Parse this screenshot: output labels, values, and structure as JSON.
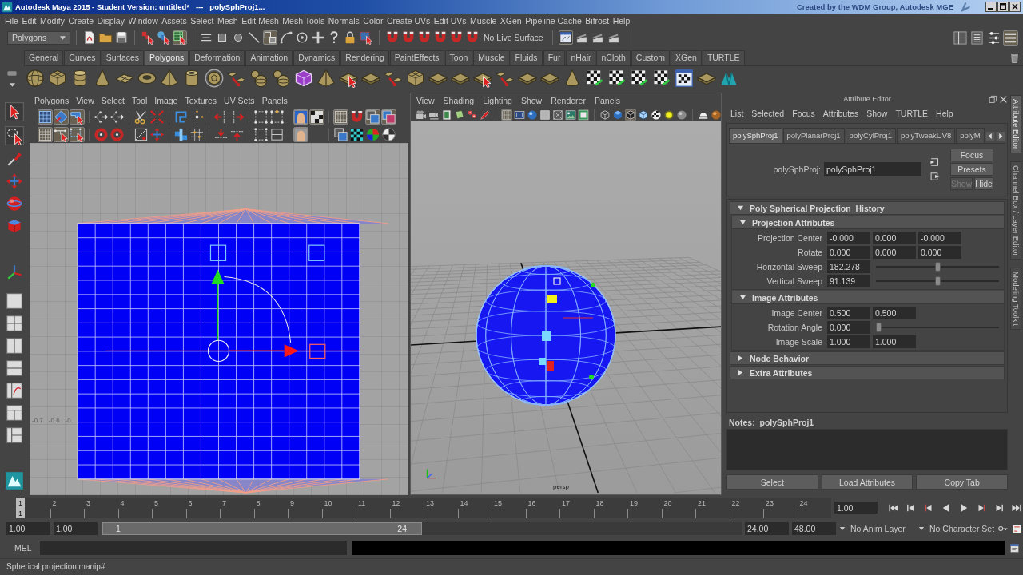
{
  "window": {
    "title": "Autodesk Maya 2015 - Student Version: untitled*   ---   polySphProj1...",
    "credit": "Created by the WDM Group, Autodesk MGE"
  },
  "menu_bar": [
    "File",
    "Edit",
    "Modify",
    "Create",
    "Display",
    "Window",
    "Assets",
    "Select",
    "Mesh",
    "Edit Mesh",
    "Mesh Tools",
    "Normals",
    "Color",
    "Create UVs",
    "Edit UVs",
    "Muscle",
    "XGen",
    "Pipeline Cache",
    "Bifrost",
    "Help"
  ],
  "status_line": {
    "menu_set": "Polygons",
    "buttons": [
      {
        "pressed": false
      },
      {
        "pressed": false
      },
      {
        "pressed": false
      },
      {
        "pressed": false
      },
      {
        "pressed": false
      },
      {
        "pressed": true
      },
      {
        "pressed": false
      },
      {
        "pressed": false
      },
      {
        "pressed": false
      },
      {
        "pressed": false
      },
      {
        "pressed": true
      },
      {
        "pressed": false
      },
      {
        "pressed": false
      },
      {
        "pressed": false
      },
      {
        "pressed": false
      },
      {
        "pressed": false
      },
      {
        "pressed": false
      },
      {
        "pressed": false
      },
      {
        "pressed": false
      },
      {
        "pressed": false
      },
      {
        "pressed": false
      },
      {
        "pressed": false
      },
      {
        "pressed": false
      }
    ],
    "live_surface": "No Live Surface",
    "render_buttons": [
      {
        "pressed": true
      },
      {
        "pressed": false
      },
      {
        "pressed": false
      },
      {
        "pressed": false
      }
    ],
    "panel_toggles": [
      {
        "pressed": false
      },
      {
        "pressed": false
      },
      {
        "pressed": false
      },
      {
        "pressed": true
      }
    ]
  },
  "shelf": {
    "tabs": [
      {
        "label": "General",
        "selected": false
      },
      {
        "label": "Curves",
        "selected": false
      },
      {
        "label": "Surfaces",
        "selected": false
      },
      {
        "label": "Polygons",
        "selected": true
      },
      {
        "label": "Deformation",
        "selected": false
      },
      {
        "label": "Animation",
        "selected": false
      },
      {
        "label": "Dynamics",
        "selected": false
      },
      {
        "label": "Rendering",
        "selected": false
      },
      {
        "label": "PaintEffects",
        "selected": false
      },
      {
        "label": "Toon",
        "selected": false
      },
      {
        "label": "Muscle",
        "selected": false
      },
      {
        "label": "Fluids",
        "selected": false
      },
      {
        "label": "Fur",
        "selected": false
      },
      {
        "label": "nHair",
        "selected": false
      },
      {
        "label": "nCloth",
        "selected": false
      },
      {
        "label": "Custom",
        "selected": false
      },
      {
        "label": "XGen",
        "selected": false
      },
      {
        "label": "TURTLE",
        "selected": false
      }
    ]
  },
  "uv_editor": {
    "menu": [
      "Polygons",
      "View",
      "Select",
      "Tool",
      "Image",
      "Textures",
      "UV Sets",
      "Panels"
    ],
    "toolbar_rows": [
      {
        "buttons": [
          {
            "pressed": true
          },
          {
            "pressed": true
          },
          {
            "pressed": true
          },
          {
            "pressed": false
          },
          {
            "pressed": false
          },
          {
            "pressed": false
          },
          {
            "pressed": false
          },
          {
            "pressed": false
          },
          {
            "pressed": false
          },
          {
            "pressed": false
          },
          {
            "pressed": false
          },
          {
            "pressed": false
          },
          {
            "pressed": false
          },
          {
            "pressed": true
          },
          {
            "pressed": true
          },
          {
            "pressed": true
          },
          {
            "pressed": false
          },
          {
            "pressed": true
          },
          {
            "pressed": true
          }
        ]
      },
      {
        "buttons": [
          {
            "pressed": true
          },
          {
            "pressed": true
          },
          {
            "pressed": true
          },
          {
            "pressed": false
          },
          {
            "pressed": false
          },
          {
            "pressed": false
          },
          {
            "pressed": false
          },
          {
            "pressed": false
          },
          {
            "pressed": false
          },
          {
            "pressed": false
          },
          {
            "pressed": false
          },
          {
            "pressed": false
          },
          {
            "pressed": false
          },
          {
            "pressed": true
          },
          {
            "pressed": false
          },
          {
            "pressed": false
          },
          {
            "pressed": false
          },
          {
            "pressed": false
          }
        ]
      }
    ],
    "axis_labels": [
      "-0.7",
      "-0.6",
      "-0."
    ]
  },
  "viewport": {
    "menu": [
      "View",
      "Shading",
      "Lighting",
      "Show",
      "Renderer",
      "Panels"
    ],
    "toolbar": [
      {
        "pressed": false
      },
      {
        "pressed": false
      },
      {
        "pressed": false
      },
      {
        "pressed": false
      },
      {
        "pressed": false
      },
      {
        "pressed": false
      },
      {
        "pressed": true
      },
      {
        "pressed": false
      },
      {
        "pressed": false
      },
      {
        "pressed": false
      },
      {
        "pressed": false
      },
      {
        "pressed": false
      },
      {
        "pressed": false
      },
      {
        "pressed": false
      },
      {
        "pressed": false
      },
      {
        "pressed": true
      },
      {
        "pressed": false
      },
      {
        "pressed": false
      },
      {
        "pressed": false
      },
      {
        "pressed": false
      },
      {
        "pressed": false
      },
      {
        "pressed": false
      }
    ],
    "camera": "persp"
  },
  "attribute_editor": {
    "title": "Attribute Editor",
    "menu": [
      "List",
      "Selected",
      "Focus",
      "Attributes",
      "Show",
      "TURTLE",
      "Help"
    ],
    "tabs": [
      {
        "label": "polySphProj1",
        "selected": true
      },
      {
        "label": "polyPlanarProj1",
        "selected": false
      },
      {
        "label": "polyCylProj1",
        "selected": false
      },
      {
        "label": "polyTweakUV8",
        "selected": false
      },
      {
        "label": "polyM",
        "selected": false
      }
    ],
    "node_label": "polySphProj:",
    "node_name": "polySphProj1",
    "buttons": [
      {
        "label": "Focus",
        "disabled": false
      },
      {
        "label": "Presets",
        "disabled": false
      },
      {
        "label": "Show",
        "disabled": true
      },
      {
        "label": "Hide",
        "disabled": false
      }
    ],
    "sections": [
      {
        "title": "Poly Spherical Projection  History",
        "expanded": true,
        "subsections": [
          {
            "title": "Projection Attributes",
            "expanded": true,
            "rows": [
              {
                "kind": "fields",
                "label": "Projection Center",
                "values": [
                  "-0.000",
                  "0.000",
                  "-0.000"
                ]
              },
              {
                "kind": "fields",
                "label": "Rotate",
                "values": [
                  "0.000",
                  "0.000",
                  "0.000"
                ]
              },
              {
                "kind": "slider",
                "label": "Horizontal Sweep",
                "values": [
                  "182.278"
                ],
                "level": 0.5
              },
              {
                "kind": "slider",
                "label": "Vertical Sweep",
                "values": [
                  "91.139"
                ],
                "level": 0.5
              }
            ]
          },
          {
            "title": "Image Attributes",
            "expanded": true,
            "rows": [
              {
                "kind": "fields",
                "label": "Image Center",
                "values": [
                  "0.500",
                  "0.500"
                ]
              },
              {
                "kind": "slider",
                "label": "Rotation Angle",
                "values": [
                  "0.000"
                ],
                "level": 0
              },
              {
                "kind": "fields",
                "label": "Image Scale",
                "values": [
                  "1.000",
                  "1.000"
                ]
              }
            ]
          }
        ]
      },
      {
        "title": "Node Behavior",
        "expanded": false
      },
      {
        "title": "Extra Attributes",
        "expanded": false
      }
    ],
    "notes_label": "Notes:  polySphProj1",
    "actions": [
      "Select",
      "Load Attributes",
      "Copy Tab"
    ]
  },
  "side_tabs": [
    {
      "label": "Attribute Editor",
      "selected": true
    },
    {
      "label": "Channel Box / Layer Editor",
      "selected": false
    },
    {
      "label": "Modeling Toolkit",
      "selected": false
    }
  ],
  "time_slider": {
    "ticks": [
      {
        "label": "1",
        "selected": true
      },
      {
        "label": "2",
        "selected": false
      },
      {
        "label": "3",
        "selected": false
      },
      {
        "label": "4",
        "selected": false
      },
      {
        "label": "5",
        "selected": false
      },
      {
        "label": "6",
        "selected": false
      },
      {
        "label": "7",
        "selected": false
      },
      {
        "label": "8",
        "selected": false
      },
      {
        "label": "9",
        "selected": false
      },
      {
        "label": "10",
        "selected": false
      },
      {
        "label": "11",
        "selected": false
      },
      {
        "label": "12",
        "selected": false
      },
      {
        "label": "13",
        "selected": false
      },
      {
        "label": "14",
        "selected": false
      },
      {
        "label": "15",
        "selected": false
      },
      {
        "label": "16",
        "selected": false
      },
      {
        "label": "17",
        "selected": false
      },
      {
        "label": "18",
        "selected": false
      },
      {
        "label": "19",
        "selected": false
      },
      {
        "label": "20",
        "selected": false
      },
      {
        "label": "21",
        "selected": false
      },
      {
        "label": "22",
        "selected": false
      },
      {
        "label": "23",
        "selected": false
      },
      {
        "label": "24",
        "selected": false
      }
    ],
    "current_frame": "1",
    "current_time": "1.00"
  },
  "range_slider": {
    "start_time": "1.00",
    "playback_start": "1.00",
    "range_start": "1",
    "range_end": "24",
    "level": 0.5,
    "playback_end": "24.00",
    "end_time": "48.00",
    "anim_layer": "No Anim Layer",
    "character_set": "No Character Set"
  },
  "command_line": {
    "language": "MEL"
  },
  "help_line": "Spherical projection manip#"
}
